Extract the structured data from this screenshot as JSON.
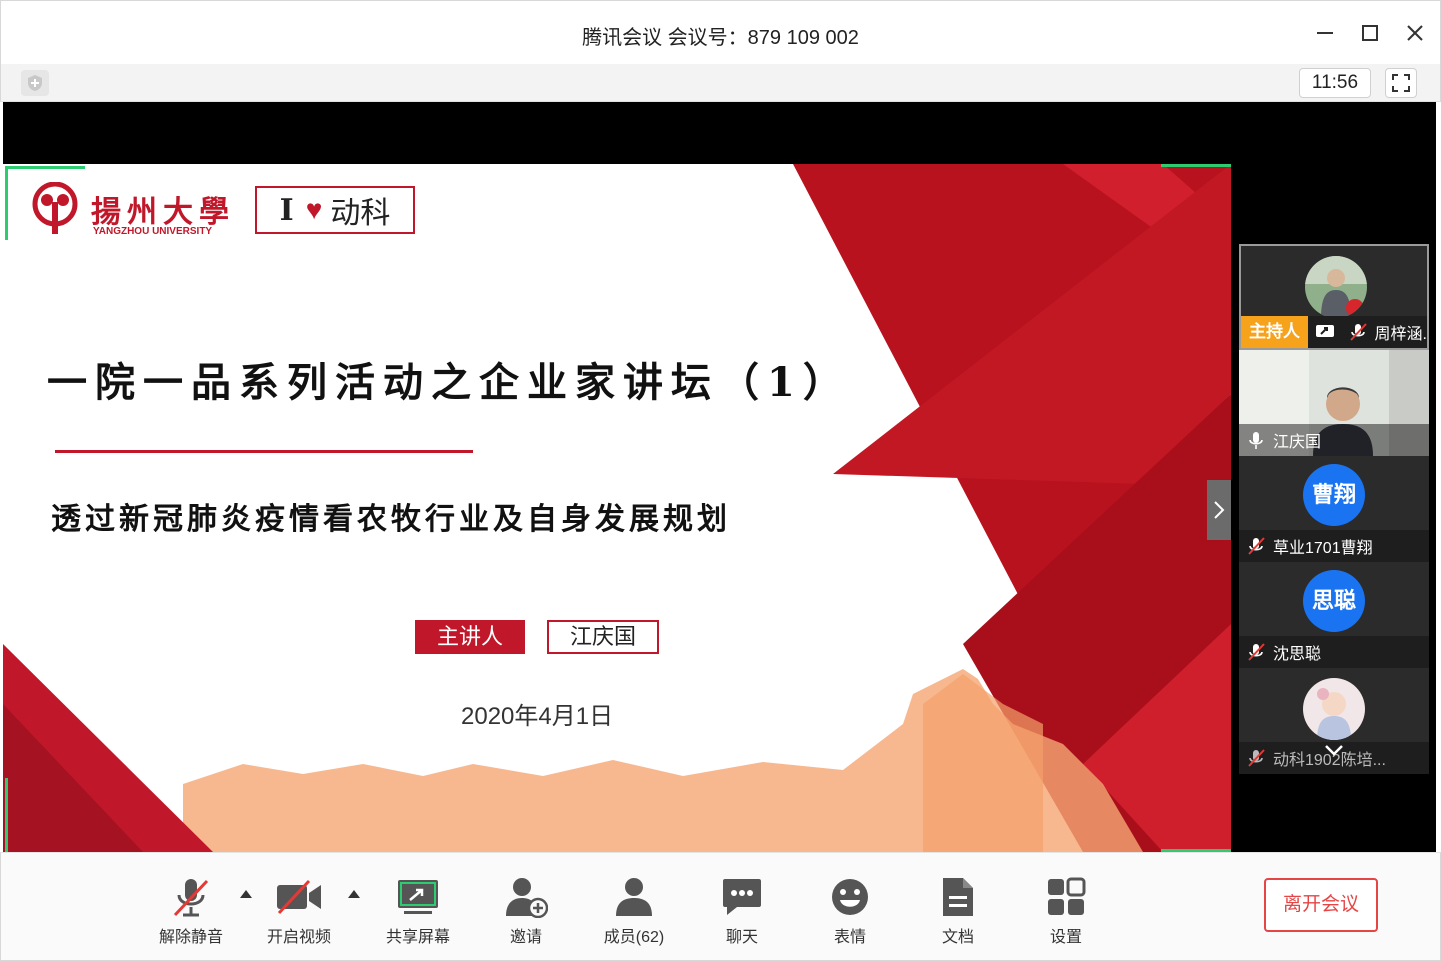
{
  "window": {
    "title": "腾讯会议 会议号：879 109 002"
  },
  "infobar": {
    "timer": "11:56"
  },
  "slide": {
    "logo_cn": "揚州大學",
    "logo_en": "YANGZHOU UNIVERSITY",
    "ilove_i": "I",
    "ilove_heart": "♥",
    "ilove_text": "动科",
    "title": "一院一品系列活动之企业家讲坛（1）",
    "subtitle": "透过新冠肺炎疫情看农牧行业及自身发展规划",
    "speaker_label": "主讲人",
    "speaker_name": "江庆国",
    "date": "2020年4月1日",
    "accent_color": "#c0182a"
  },
  "participants": [
    {
      "name": "周梓涵.",
      "tag": "主持人",
      "avatar": "photo",
      "mic": "muted",
      "sharing": true
    },
    {
      "name": "江庆国",
      "avatar": "video",
      "mic": "on"
    },
    {
      "name": "草业1701曹翔",
      "avatar_text": "曹翔",
      "mic": "muted"
    },
    {
      "name": "沈思聪",
      "avatar_text": "思聪",
      "mic": "muted"
    },
    {
      "name": "动科1902陈培...",
      "avatar": "photo",
      "mic": "muted"
    }
  ],
  "toolbar": {
    "unmute": "解除静音",
    "video": "开启视频",
    "share": "共享屏幕",
    "invite": "邀请",
    "members": "成员(62)",
    "chat": "聊天",
    "emoji": "表情",
    "docs": "文档",
    "settings": "设置",
    "leave": "离开会议"
  }
}
